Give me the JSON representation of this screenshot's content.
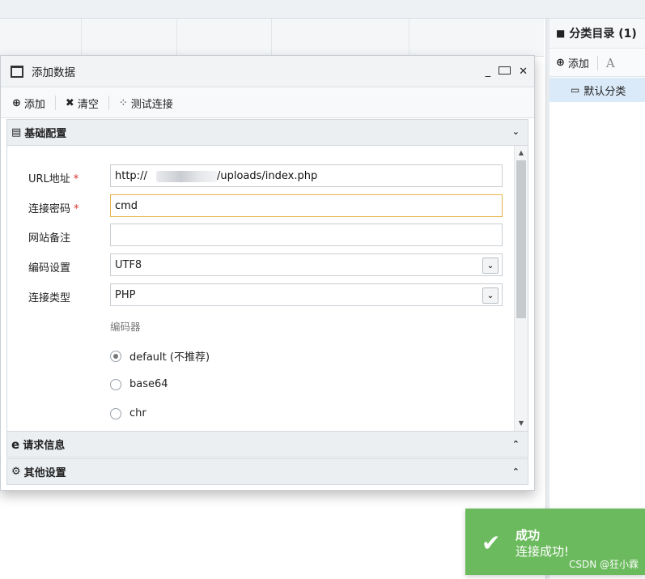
{
  "right_panel": {
    "title": "分类目录 (1)",
    "toolbar_add": "添加",
    "toolbar_ghost": "A",
    "list_items": [
      "默认分类"
    ]
  },
  "dialog": {
    "title": "添加数据",
    "controls": {
      "minimize": "_",
      "close": "✕"
    },
    "toolbar": {
      "add": "添加",
      "clear": "清空",
      "test": "测试连接"
    },
    "sections": {
      "basic": "基础配置",
      "request": "请求信息",
      "other": "其他设置"
    },
    "form": {
      "url_label": "URL地址",
      "url_prefix": "http://",
      "url_suffix": "/uploads/index.php",
      "password_label": "连接密码",
      "password_value": "cmd",
      "note_label": "网站备注",
      "note_value": "",
      "encoding_label": "编码设置",
      "encoding_value": "UTF8",
      "type_label": "连接类型",
      "type_value": "PHP",
      "encoder_label": "编码器",
      "required_mark": "*",
      "encoders": [
        {
          "label": "default (不推荐)",
          "checked": true
        },
        {
          "label": "base64",
          "checked": false
        },
        {
          "label": "chr",
          "checked": false
        }
      ]
    }
  },
  "toast": {
    "title": "成功",
    "message": "连接成功!",
    "color": "#6cba5e"
  },
  "watermark": "CSDN @狂小霖"
}
